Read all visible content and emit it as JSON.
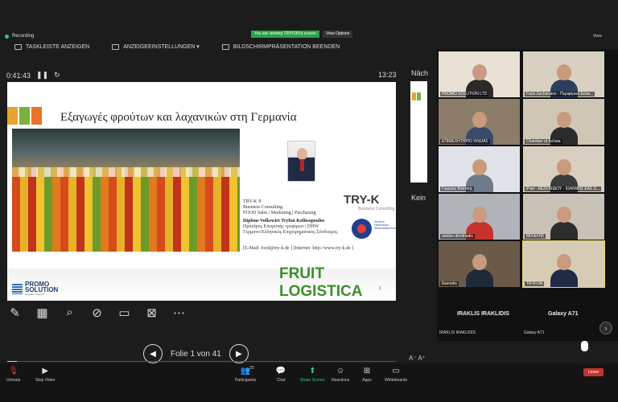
{
  "recording": {
    "label": "Recording"
  },
  "share_banner": {
    "viewing": "You are viewing TRYFON's screen",
    "view_options": "View Options"
  },
  "toolbar": {
    "items": [
      {
        "label": "TASKLEISTE ANZEIGEN"
      },
      {
        "label": "ANZEIGEEINSTELLUNGEN ▾"
      },
      {
        "label": "BILDSCHIRMPRÄSENTATION BEENDEN"
      }
    ]
  },
  "timer": {
    "elapsed": "0:41:43",
    "clock": "13:23",
    "pause_icon": "pause-icon",
    "reset_icon": "restart-icon"
  },
  "slide": {
    "title": "Εξαγωγές φρούτων και λαχανικών στη Γερμανία",
    "square_colors": [
      "#e8a432",
      "#7ab23c",
      "#e8722a"
    ],
    "tryk_logo": "TRY-K",
    "tryk_sub": "Business Consulting",
    "info_lines": [
      "TRY-K ®",
      "Business Consulting",
      "FOOD Sales | Marketing | Purchasing"
    ],
    "name_line": "Diplom-Volkswirt  Tryfon Kolitsopoulos",
    "role_lines": [
      "Πρόεδρος Επιτροπής τροφίμων | DHW",
      "Γερμανο-Ελληνικός Επιχειρηματικός Σύνδεσμος"
    ],
    "contact": "[E-Mail: food@try-k.de ]  [Internet: http://www.try-k.de ]",
    "eu_text": "Deutsch Hellenische Wirtschaftsvereinigung",
    "promo_name": "PROMO",
    "promo_name2": "SOLUTION",
    "promo_sub": "EXHIBIT CREATE",
    "fruit": "FRUIT",
    "logistica": "LOGISTICA",
    "page_mark": "1"
  },
  "annotation_tools": [
    {
      "name": "pen-icon",
      "glyph": "✎"
    },
    {
      "name": "slides-icon",
      "glyph": "▦"
    },
    {
      "name": "magnifier-icon",
      "glyph": "⌕"
    },
    {
      "name": "laser-icon",
      "glyph": "⊘"
    },
    {
      "name": "subtitles-icon",
      "glyph": "▭"
    },
    {
      "name": "camera-off-icon",
      "glyph": "⊠"
    },
    {
      "name": "more-icon",
      "glyph": "⋯"
    }
  ],
  "navigation": {
    "label": "Folie 1 von 41",
    "prev": "◀",
    "next": "▶",
    "progress": 0.0244
  },
  "side": {
    "next_label": "Näch",
    "none_label": "Kein"
  },
  "gallery": {
    "title": "View",
    "tiles": [
      {
        "name": "PROMO SOLUTION LTD",
        "bg": "#e9e2d4",
        "shirt": "#2a2a2a"
      },
      {
        "name": "Faris Zacharatos - Περιφέρεια Δυτικ...",
        "bg": "#d8d0c0",
        "shirt": "#2c3f5f"
      },
      {
        "name": "ΕΠΙΜΕΛΗΤΗΡΙΟ ΗΛΕΙΑΣ",
        "bg": "#8b7d6a",
        "shirt": "#3a4a6a"
      },
      {
        "name": "Chamber of Achaia",
        "bg": "#cfc6b6",
        "shirt": "#2b2b2b"
      },
      {
        "name": "Γιώργος Κούτσης",
        "bg": "#e0e4ea",
        "shirt": "#6f7a8a"
      },
      {
        "name": "iPad - ΚΕΣΚΙΝΙΔΟΥ - ΙΩΑΝΝΗΣ ΕΑΣ Ω...",
        "bg": "#d9cfc1",
        "shirt": "#3b3b3b"
      },
      {
        "name": "debbie dimitriadis",
        "bg": "#b0b4b8",
        "shirt": "#c8322c"
      },
      {
        "name": "ΜΙΧΑΛΗΣ",
        "bg": "#c9c3b7",
        "shirt": "#2d2d2d"
      },
      {
        "name": "Ikarnetis",
        "bg": "#6b5a4a",
        "shirt": "#1e2a3a"
      },
      {
        "name": "TRYFON",
        "bg": "#d6ccb5",
        "shirt": "#1f2a44"
      }
    ],
    "big_left": "IRAKLIS IRAKLIDIS",
    "big_right": "Galaxy A71",
    "small_left": "IRAKLIS IRAKLIDIS",
    "small_right": "Galaxy A71"
  },
  "bottom_bar": {
    "unmute": "Unmute",
    "stop_video": "Stop Video",
    "participants": "Participants",
    "participants_count": "20",
    "chat": "Chat",
    "share_screen": "Share Screen",
    "reactions": "Reactions",
    "apps": "Apps",
    "whiteboards": "Whiteboards",
    "leave": "Leave"
  },
  "font_size_controls": "A⁻  A⁺"
}
